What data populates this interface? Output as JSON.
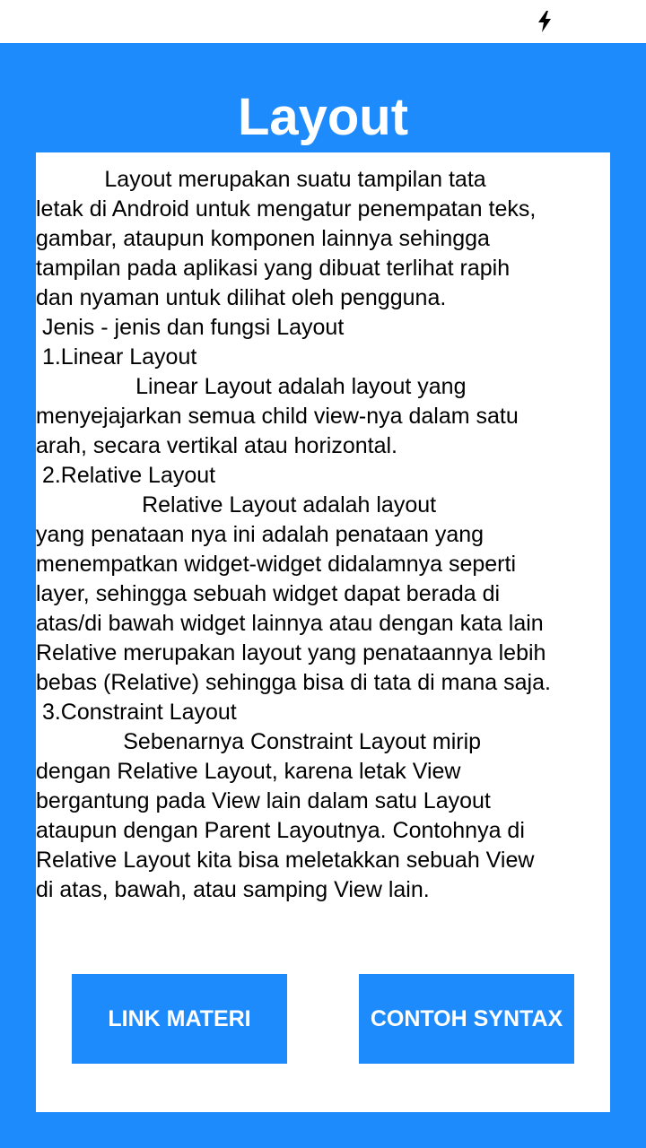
{
  "status_bar": {
    "icon": "flash-icon"
  },
  "header": {
    "title": "Layout"
  },
  "content": {
    "lines": [
      "           Layout merupakan suatu tampilan tata",
      "letak di Android untuk mengatur penempatan teks,",
      "gambar, ataupun komponen lainnya sehingga",
      "tampilan pada aplikasi yang dibuat terlihat rapih",
      "dan nyaman untuk dilihat oleh pengguna.",
      " Jenis - jenis dan fungsi Layout",
      " 1.Linear Layout",
      "                Linear Layout adalah layout yang",
      "menyejajarkan semua child view-nya dalam satu",
      "arah, secara vertikal atau horizontal.",
      " 2.Relative Layout",
      "                 Relative Layout adalah layout",
      "yang penataan nya ini adalah penataan yang",
      "menempatkan widget-widget didalamnya seperti",
      "layer, sehingga sebuah widget dapat berada di",
      "atas/di bawah widget lainnya atau dengan kata lain",
      "Relative merupakan layout yang penataannya lebih",
      "bebas (Relative) sehingga bisa di tata di mana saja.",
      " 3.Constraint Layout",
      "              Sebenarnya Constraint Layout mirip",
      "dengan Relative Layout, karena letak View",
      "bergantung pada View lain dalam satu Layout",
      "ataupun dengan Parent Layoutnya. Contohnya di",
      "Relative Layout kita bisa meletakkan sebuah View",
      "di atas, bawah, atau samping View lain."
    ]
  },
  "buttons": {
    "link_materi": "LINK MATERI",
    "contoh_syntax": "CONTOH SYNTAX"
  }
}
